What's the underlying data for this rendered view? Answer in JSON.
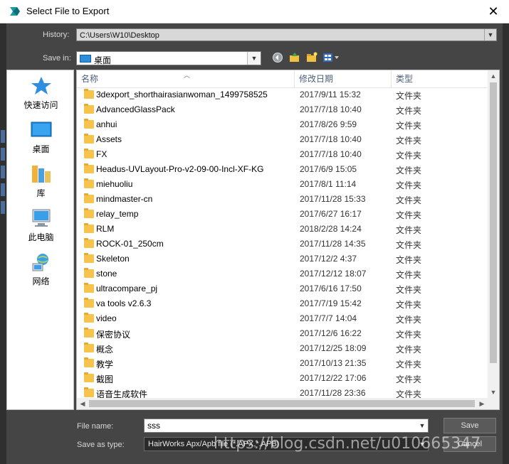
{
  "window": {
    "title": "Select File to Export",
    "close_glyph": "✕"
  },
  "history": {
    "label": "History:",
    "value": "C:\\Users\\W10\\Desktop"
  },
  "save_in": {
    "label": "Save in:",
    "value": "桌面"
  },
  "places": [
    {
      "label": "快速访问",
      "icon": "star-icon"
    },
    {
      "label": "桌面",
      "icon": "desktop-icon"
    },
    {
      "label": "库",
      "icon": "library-icon"
    },
    {
      "label": "此电脑",
      "icon": "computer-icon"
    },
    {
      "label": "网络",
      "icon": "network-icon"
    }
  ],
  "columns": {
    "name": "名称",
    "date": "修改日期",
    "type": "类型"
  },
  "files": [
    {
      "name": "3dexport_shorthairasianwoman_1499758525",
      "date": "2017/9/11 15:32",
      "type": "文件夹"
    },
    {
      "name": "AdvancedGlassPack",
      "date": "2017/7/18 10:40",
      "type": "文件夹"
    },
    {
      "name": "anhui",
      "date": "2017/8/26 9:59",
      "type": "文件夹"
    },
    {
      "name": "Assets",
      "date": "2017/7/18 10:40",
      "type": "文件夹"
    },
    {
      "name": "FX",
      "date": "2017/7/18 10:40",
      "type": "文件夹"
    },
    {
      "name": "Headus-UVLayout-Pro-v2-09-00-Incl-XF-KG",
      "date": "2017/6/9 15:05",
      "type": "文件夹"
    },
    {
      "name": "miehuoliu",
      "date": "2017/8/1 11:14",
      "type": "文件夹"
    },
    {
      "name": "mindmaster-cn",
      "date": "2017/11/28 15:33",
      "type": "文件夹"
    },
    {
      "name": "relay_temp",
      "date": "2017/6/27 16:17",
      "type": "文件夹"
    },
    {
      "name": "RLM",
      "date": "2018/2/28 14:24",
      "type": "文件夹"
    },
    {
      "name": "ROCK-01_250cm",
      "date": "2017/11/28 14:35",
      "type": "文件夹"
    },
    {
      "name": "Skeleton",
      "date": "2017/12/2 4:37",
      "type": "文件夹"
    },
    {
      "name": "stone",
      "date": "2017/12/12 18:07",
      "type": "文件夹"
    },
    {
      "name": "ultracompare_pj",
      "date": "2017/6/16 17:50",
      "type": "文件夹"
    },
    {
      "name": "va tools v2.6.3",
      "date": "2017/7/19 15:42",
      "type": "文件夹"
    },
    {
      "name": "video",
      "date": "2017/7/7 14:04",
      "type": "文件夹"
    },
    {
      "name": "保密协议",
      "date": "2017/12/6 16:22",
      "type": "文件夹"
    },
    {
      "name": "概念",
      "date": "2017/12/25 18:09",
      "type": "文件夹"
    },
    {
      "name": "教学",
      "date": "2017/10/13 21:35",
      "type": "文件夹"
    },
    {
      "name": "截图",
      "date": "2017/12/22 17:06",
      "type": "文件夹"
    },
    {
      "name": "语音生成软件",
      "date": "2017/11/28 23:36",
      "type": "文件夹"
    }
  ],
  "file_name": {
    "label": "File name:",
    "value": "sss"
  },
  "save_as_type": {
    "label": "Save as type:",
    "value": "HairWorks Apx/Apb file (*.APX,*.APB)"
  },
  "buttons": {
    "save": "Save",
    "cancel": "Cancel"
  },
  "watermark": "https://blog.csdn.net/u010665347",
  "colors": {
    "folder": "#f6c34c",
    "dialog_bg": "#454545",
    "desktop_blue": "#2c8fdc"
  }
}
